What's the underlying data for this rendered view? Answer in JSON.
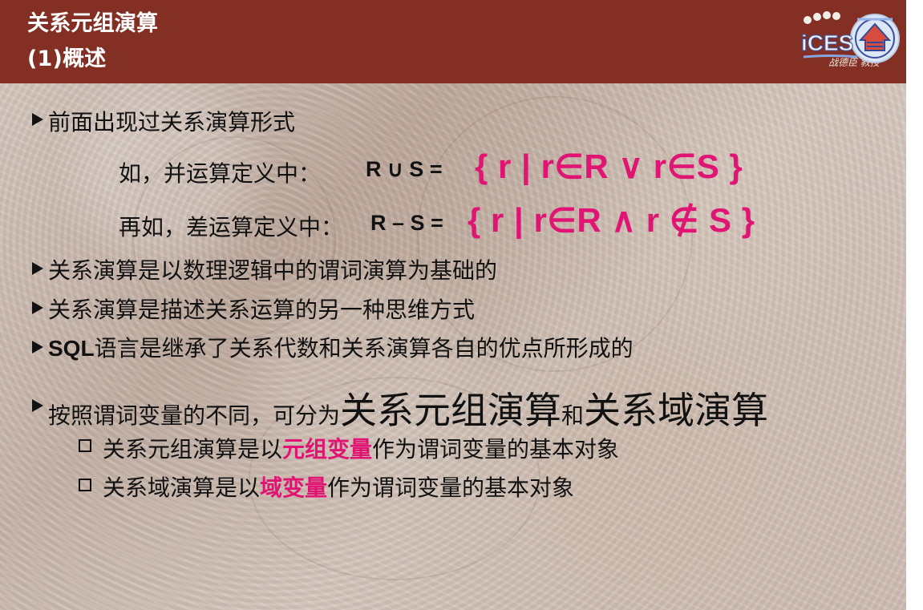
{
  "header": {
    "title_line_1": "关系元组演算",
    "title_line_2": "(1)概述",
    "logo_text": "战德臣 教授"
  },
  "body": {
    "line_1": "前面出现过关系演算形式",
    "formula_1_label": "如，并运算定义中：",
    "formula_1_left": "R ∪ S =",
    "formula_1_right": "{ r | r∈R ∨ r∈S }",
    "formula_2_label": "再如，差运算定义中：",
    "formula_2_left": "R – S =",
    "formula_2_right": "{ r | r∈R ∧ r ∉ S }",
    "line_2": "关系演算是以数理逻辑中的谓词演算为基础的",
    "line_3": "关系演算是描述关系运算的另一种思维方式",
    "line_4_prefix": "SQL",
    "line_4_suffix": "语言是继承了关系代数和关系演算各自的优点所形成的",
    "line_5_prefix": "按照谓词变量的不同，可分为",
    "line_5_term_1": "关系元组演算",
    "line_5_conjunction": "和",
    "line_5_term_2": "关系域演算",
    "sub_1_prefix": "关系元组演算是以",
    "sub_1_highlight": "元组变量",
    "sub_1_suffix": "作为谓词变量的基本对象",
    "sub_2_prefix": "关系域演算是以",
    "sub_2_highlight": "域变量",
    "sub_2_suffix": "作为谓词变量的基本对象"
  },
  "colors": {
    "header_background": "#842f23",
    "highlight": "#e01472",
    "text": "#111111"
  }
}
